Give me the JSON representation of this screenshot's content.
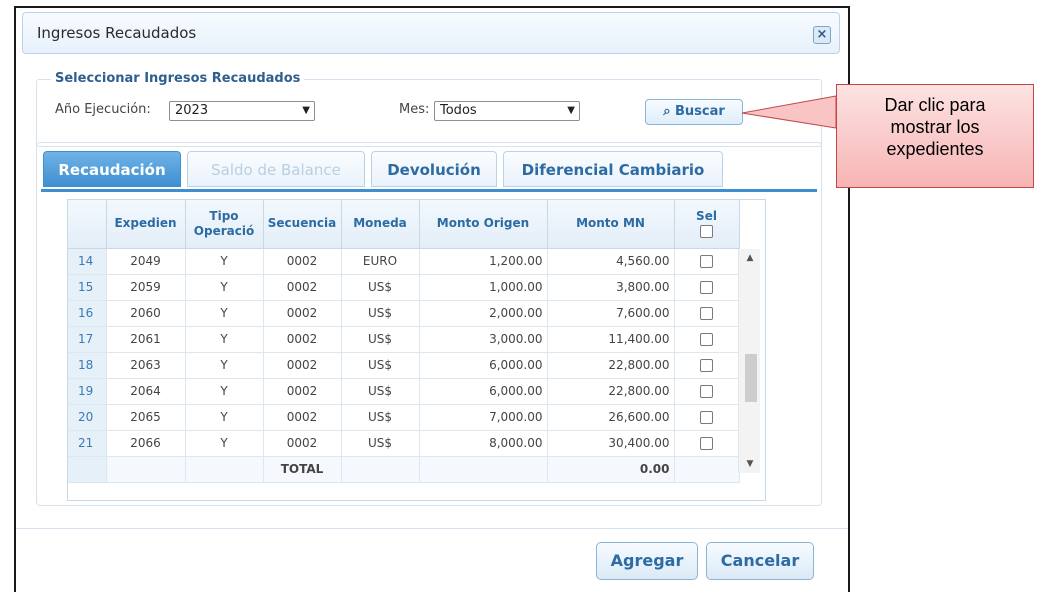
{
  "dialog": {
    "title": "Ingresos Recaudados",
    "close_icon": "close-icon",
    "filter": {
      "legend": "Seleccionar Ingresos Recaudados",
      "anio_label": "Año Ejecución:",
      "anio_value": "2023",
      "mes_label": "Mes:",
      "mes_value": "Todos",
      "buscar_label": "Buscar",
      "buscar_icon": "search-icon"
    },
    "tabs": [
      {
        "label": "Recaudación",
        "state": "active"
      },
      {
        "label": "Saldo de Balance",
        "state": "disabled"
      },
      {
        "label": "Devolución",
        "state": "normal"
      },
      {
        "label": "Diferencial Cambiario",
        "state": "normal"
      }
    ],
    "grid": {
      "headers": [
        "Expedien",
        "Tipo\nOperació",
        "Secuencia",
        "Moneda",
        "Monto Origen",
        "Monto MN",
        "Sel"
      ],
      "rows": [
        {
          "n": "14",
          "exp": "2049",
          "tipo": "Y",
          "sec": "0002",
          "moneda": "EURO",
          "origen": "1,200.00",
          "mn": "4,560.00"
        },
        {
          "n": "15",
          "exp": "2059",
          "tipo": "Y",
          "sec": "0002",
          "moneda": "US$",
          "origen": "1,000.00",
          "mn": "3,800.00"
        },
        {
          "n": "16",
          "exp": "2060",
          "tipo": "Y",
          "sec": "0002",
          "moneda": "US$",
          "origen": "2,000.00",
          "mn": "7,600.00"
        },
        {
          "n": "17",
          "exp": "2061",
          "tipo": "Y",
          "sec": "0002",
          "moneda": "US$",
          "origen": "3,000.00",
          "mn": "11,400.00"
        },
        {
          "n": "18",
          "exp": "2063",
          "tipo": "Y",
          "sec": "0002",
          "moneda": "US$",
          "origen": "6,000.00",
          "mn": "22,800.00"
        },
        {
          "n": "19",
          "exp": "2064",
          "tipo": "Y",
          "sec": "0002",
          "moneda": "US$",
          "origen": "6,000.00",
          "mn": "22,800.00"
        },
        {
          "n": "20",
          "exp": "2065",
          "tipo": "Y",
          "sec": "0002",
          "moneda": "US$",
          "origen": "7,000.00",
          "mn": "26,600.00"
        },
        {
          "n": "21",
          "exp": "2066",
          "tipo": "Y",
          "sec": "0002",
          "moneda": "US$",
          "origen": "8,000.00",
          "mn": "30,400.00"
        }
      ],
      "total_label": "TOTAL",
      "total_value": "0.00"
    },
    "buttons": {
      "agregar": "Agregar",
      "cancelar": "Cancelar"
    }
  },
  "callout": {
    "text": "Dar clic para\nmostrar los\nexpedientes"
  },
  "colors": {
    "accent": "#3f8fd0",
    "callout_fill": "#f7b4b4",
    "callout_border": "#c24848"
  }
}
